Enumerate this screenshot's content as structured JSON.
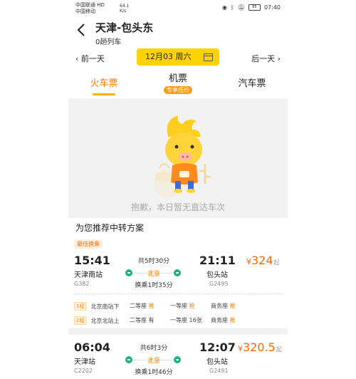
{
  "status_bar": {
    "carrier1": "中国联通 HD",
    "carrier2": "中国移动",
    "network": "64.1 K/s",
    "battery": "85",
    "time": "07:40"
  },
  "header": {
    "route": "天津-包头东",
    "train_count": "0趟列车",
    "back_icon": "chevron-left-icon"
  },
  "date_bar": {
    "prev": "前一天",
    "date": "12月03 周六",
    "next": "后一天"
  },
  "tabs": {
    "train": "火车票",
    "flight": "机票",
    "flight_promo": "专享低价",
    "bus": "汽车票"
  },
  "empty": {
    "message": "抱歉，本日暂无直达车次"
  },
  "recommend": {
    "title": "为您推荐中转方案"
  },
  "plan1": {
    "badge": "最佳换乘",
    "depart_time": "15:41",
    "depart_station": "天津南站",
    "train1": "G382",
    "total": "共5时30分",
    "via": "北京",
    "transfer": "换乘1时35分",
    "arrive_time": "21:11",
    "arrive_station": "包头站",
    "train2": "G2495",
    "price_symbol": "¥",
    "price": "324",
    "price_suffix": "起",
    "leg1": {
      "tag": "1程",
      "route": "北京南站下",
      "seat1": "二等座",
      "seat1_status": "抢",
      "seat2": "一等座",
      "seat2_status": "抢",
      "seat3": "商务座",
      "seat3_status": "抢"
    },
    "leg2": {
      "tag": "2程",
      "route": "北京北站上",
      "seat1": "二等座",
      "seat1_status": "有",
      "seat2": "一等座",
      "seat2_status": "16张",
      "seat3": "商务座",
      "seat3_status": "抢"
    }
  },
  "plan2": {
    "depart_time": "06:04",
    "depart_station": "天津站",
    "train1": "C2202",
    "total": "共6时3分",
    "via": "北京",
    "transfer": "换乘1时46分",
    "arrive_time": "12:07",
    "arrive_station": "包头站",
    "train2": "G2491",
    "price_symbol": "¥",
    "price": "320.5",
    "price_suffix": "起"
  },
  "colors": {
    "accent": "#ff7a00",
    "date_pill": "#ffd200",
    "green": "#1fb37a"
  }
}
